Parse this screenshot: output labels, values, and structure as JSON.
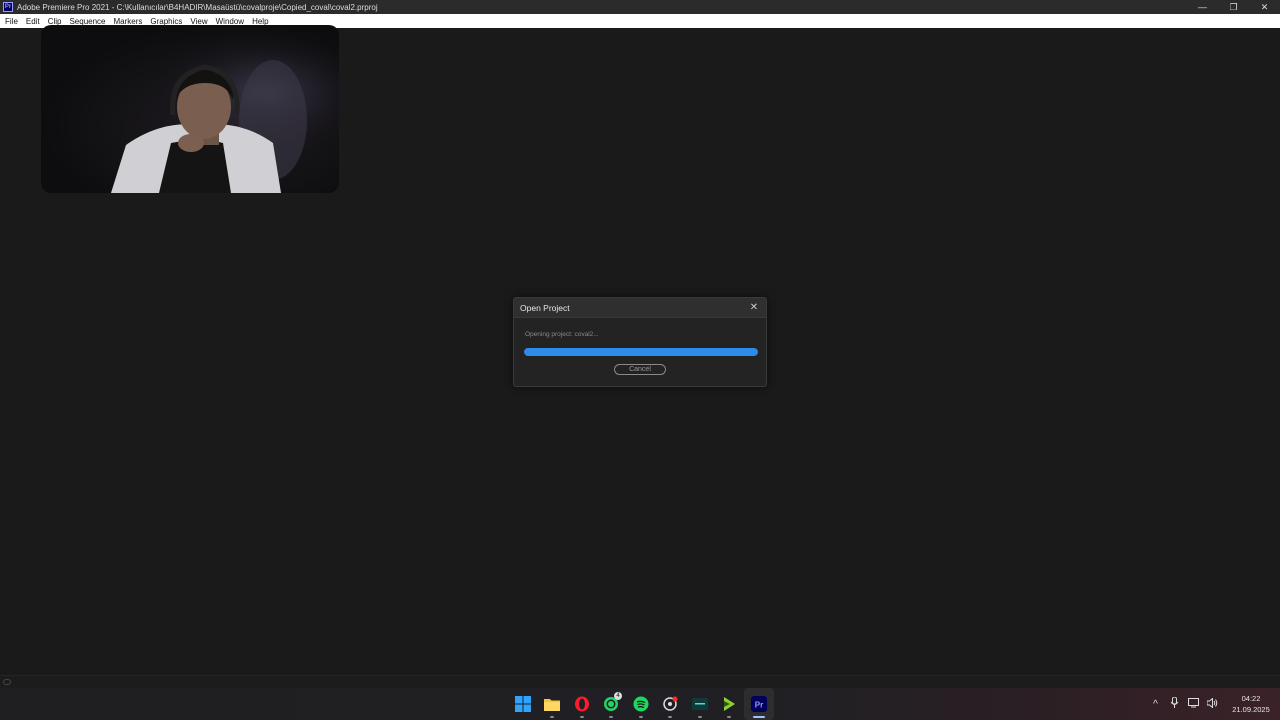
{
  "window": {
    "title": "Adobe Premiere Pro 2021 - C:\\Kullanıcılar\\B4HADIR\\Masaüstü\\covalproje\\Copied_coval\\coval2.prproj",
    "app_icon_label": "Pr",
    "controls": {
      "minimize": "—",
      "restore": "❐",
      "close": "✕"
    }
  },
  "menu": [
    "File",
    "Edit",
    "Clip",
    "Sequence",
    "Markers",
    "Graphics",
    "View",
    "Window",
    "Help"
  ],
  "dialog": {
    "title": "Open Project",
    "close_glyph": "✕",
    "status": "Opening project: coval2...",
    "progress": 1.0,
    "cancel_label": "Cancel",
    "accent": "#2d8ceb"
  },
  "taskbar": {
    "apps": [
      {
        "name": "start-icon",
        "active": false
      },
      {
        "name": "file-explorer-icon",
        "active": false
      },
      {
        "name": "opera-icon",
        "active": false
      },
      {
        "name": "whatsapp-icon",
        "active": false,
        "badge": "4"
      },
      {
        "name": "spotify-icon",
        "active": false
      },
      {
        "name": "steelseries-icon",
        "active": false
      },
      {
        "name": "terminal-icon",
        "active": false
      },
      {
        "name": "media-player-icon",
        "active": false
      },
      {
        "name": "premiere-icon",
        "active": true
      }
    ],
    "tray": {
      "chevron": "^",
      "mic": "🎤",
      "network": "▭",
      "volume": "🔊"
    },
    "time": "04:22",
    "date": "21.09.2025"
  }
}
